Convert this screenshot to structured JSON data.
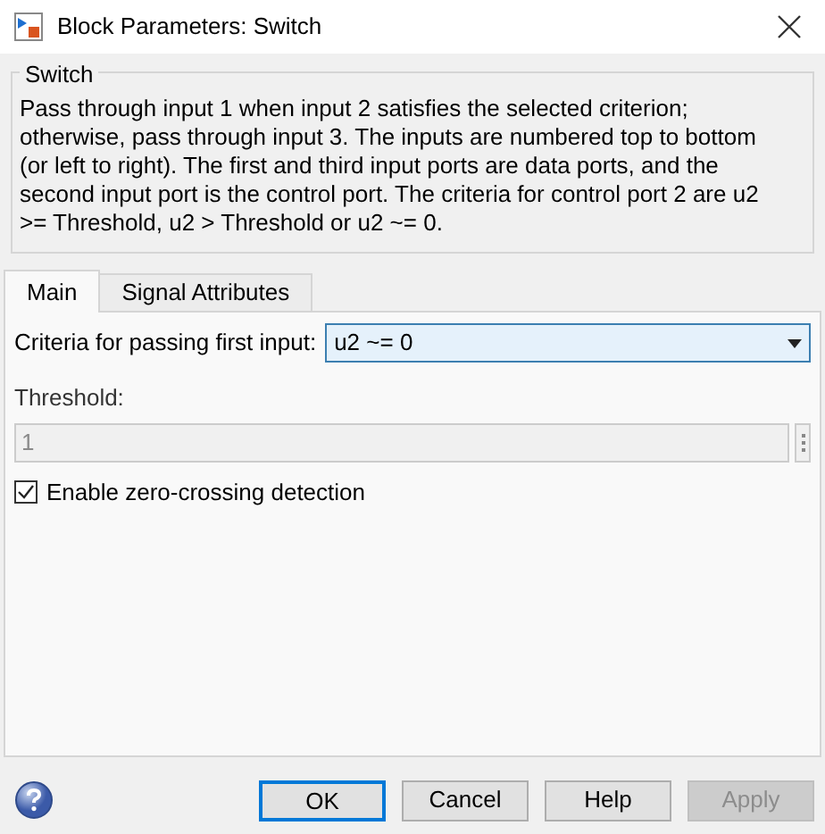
{
  "window": {
    "title": "Block Parameters: Switch"
  },
  "group": {
    "title": "Switch",
    "description": "Pass through input 1 when input 2 satisfies the selected criterion; otherwise, pass through input 3. The inputs are numbered top to bottom (or left to right). The first and third input ports are data ports, and the second input port is the control port. The criteria for control port 2 are u2 >= Threshold, u2 > Threshold or u2 ~= 0."
  },
  "tabs": [
    {
      "label": "Main",
      "selected": true
    },
    {
      "label": "Signal Attributes",
      "selected": false
    }
  ],
  "criteria": {
    "label": "Criteria for passing first input:",
    "value": "u2 ~= 0"
  },
  "threshold": {
    "label": "Threshold:",
    "value": "1",
    "disabled": true
  },
  "zero_crossing": {
    "label": "Enable zero-crossing detection",
    "checked": true
  },
  "buttons": [
    {
      "label": "OK",
      "default": true,
      "disabled": false
    },
    {
      "label": "Cancel",
      "default": false,
      "disabled": false
    },
    {
      "label": "Help",
      "default": false,
      "disabled": false
    },
    {
      "label": "Apply",
      "default": false,
      "disabled": true
    }
  ]
}
